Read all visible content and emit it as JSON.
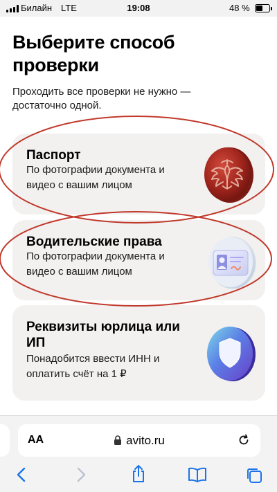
{
  "status_bar": {
    "carrier": "Билайн",
    "network": "LTE",
    "time": "19:08",
    "battery_percent": "48 %",
    "battery_level": 0.48,
    "signal_bars": 4
  },
  "page": {
    "title": "Выберите способ проверки",
    "subtitle": "Проходить все проверки не нужно — достаточно одной."
  },
  "options": [
    {
      "title": "Паспорт",
      "description": "По фотографии документа и видео с вашим лицом",
      "icon": "passport-coat-of-arms-icon"
    },
    {
      "title": "Водительские права",
      "description": "По фотографии документа и видео с вашим лицом",
      "icon": "drivers-license-card-icon"
    },
    {
      "title": "Реквизиты юрлица или ИП",
      "description": "Понадобится ввести ИНН и оплатить счёт на 1 ₽",
      "icon": "shield-icon"
    }
  ],
  "browser": {
    "text_size_label": "AA",
    "url": "avito.ru",
    "toolbar": [
      "back-icon",
      "forward-icon",
      "share-icon",
      "bookmarks-icon",
      "tabs-icon"
    ]
  },
  "colors": {
    "card_background": "#f2f1f0",
    "annotation_red": "#c0392b",
    "browser_accent": "#1a73e8",
    "passport_red": "#a0251d",
    "shield_blue": "#4a62d8"
  }
}
